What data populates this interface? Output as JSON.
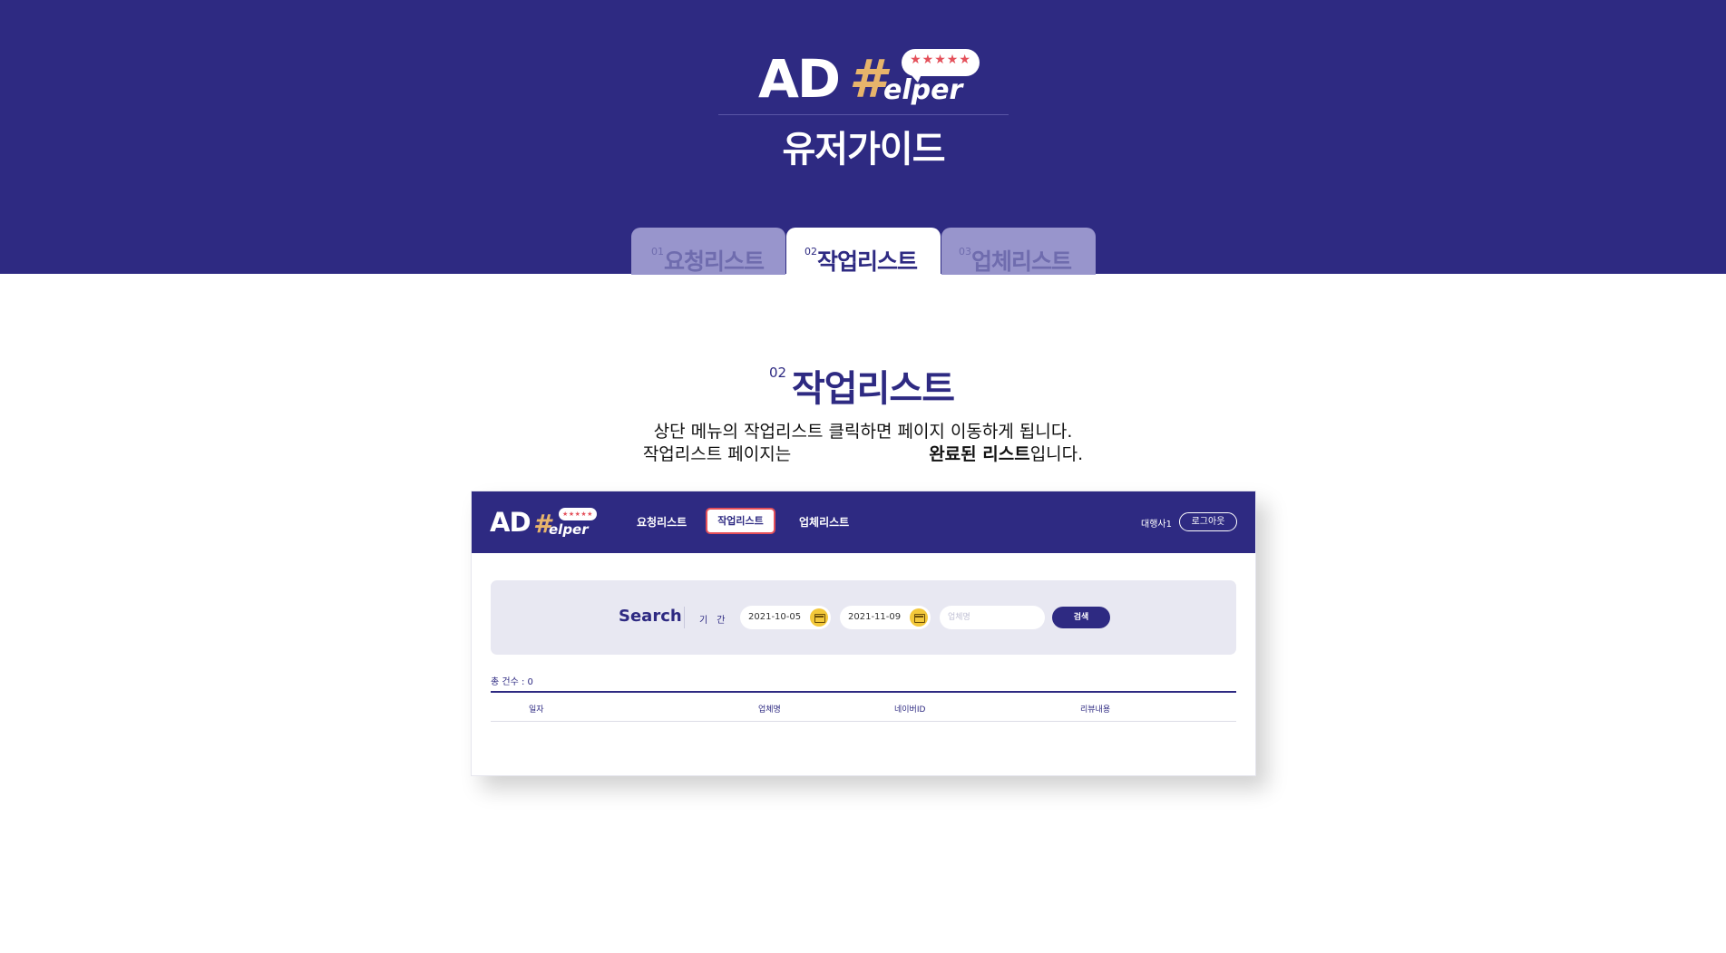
{
  "hero": {
    "logo": {
      "ad": "AD",
      "hash": "#",
      "elper": "elper",
      "stars": "★★★★★"
    },
    "title": "유저가이드",
    "tabs": [
      {
        "num": "01",
        "label": "요청리스트",
        "active": false
      },
      {
        "num": "02",
        "label": "작업리스트",
        "active": true
      },
      {
        "num": "03",
        "label": "업체리스트",
        "active": false
      }
    ]
  },
  "section": {
    "num": "02",
    "title": "작업리스트",
    "desc_line1": "상단 메뉴의 작업리스트 클릭하면 페이지 이동하게 됩니다.",
    "desc_line2_prefix": "작업리스트 페이지는",
    "desc_line2_bold": "완료된 리스트",
    "desc_line2_suffix": "입니다."
  },
  "screenshot": {
    "logo": {
      "ad": "AD",
      "hash": "#",
      "elper": "elper",
      "stars": "★★★★★"
    },
    "nav": [
      "요청리스트",
      "작업리스트",
      "업체리스트"
    ],
    "active_nav": "작업리스트",
    "user": "대행사1",
    "logout": "로그아웃",
    "search": {
      "label": "Search",
      "period_label": "기간",
      "date_from": "2021-10-05",
      "date_to": "2021-11-09",
      "keyword_placeholder": "업체명",
      "button": "검색"
    },
    "total": "총 건수 : 0",
    "columns": [
      "일자",
      "업체명",
      "네이버ID",
      "리뷰내용"
    ]
  },
  "colors": {
    "brand": "#2e2a82",
    "accent": "#e4505a",
    "gold": "#e7b46b",
    "tab_inactive": "#9895cc"
  }
}
